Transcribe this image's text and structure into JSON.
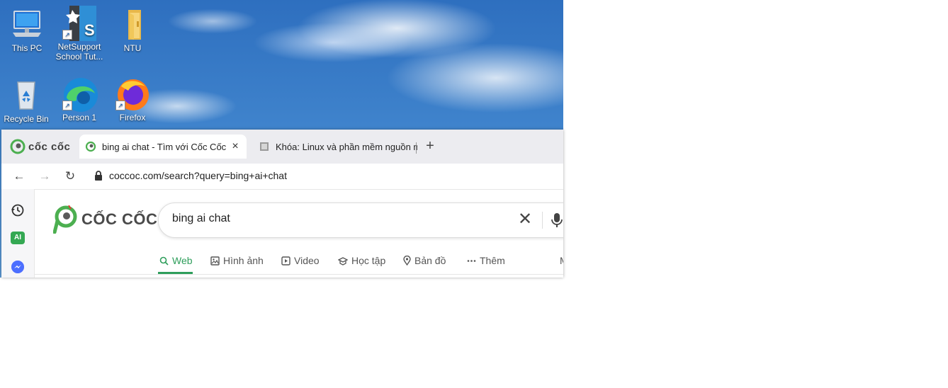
{
  "desktop": {
    "icons": [
      {
        "label": "This PC"
      },
      {
        "label": "NetSupport School Tut..."
      },
      {
        "label": "NTU"
      },
      {
        "label": "Recycle Bin"
      },
      {
        "label": "Person 1"
      },
      {
        "label": "Firefox"
      }
    ]
  },
  "browser": {
    "brand": "cốc cốc",
    "tabs": [
      {
        "title": "bing ai chat - Tìm với Cốc Cốc",
        "close_icon": "×"
      },
      {
        "title": "Khóa: Linux và phần mềm nguồn m"
      }
    ],
    "new_tab": "+",
    "nav": {
      "back": "←",
      "forward": "→",
      "reload": "↻"
    },
    "address": "coccoc.com/search?query=bing+ai+chat",
    "sidebar": {
      "ai_badge": "AI"
    }
  },
  "page": {
    "logo_text": "CỐC CỐC",
    "search": {
      "value": "bing ai chat",
      "clear": "✕"
    },
    "verticals": [
      {
        "label": "Web",
        "icon": "search-icon",
        "active": true
      },
      {
        "label": "Hình ảnh",
        "icon": "image-icon"
      },
      {
        "label": "Video",
        "icon": "video-icon"
      },
      {
        "label": "Học tập",
        "icon": "graduation-icon"
      },
      {
        "label": "Bản đồ",
        "icon": "map-pin-icon"
      },
      {
        "label": "Thêm",
        "icon": "more-dots-icon"
      }
    ],
    "overflow_text": "M"
  },
  "colors": {
    "accent": "#2e9e5b",
    "sky": "#3f83cc"
  }
}
